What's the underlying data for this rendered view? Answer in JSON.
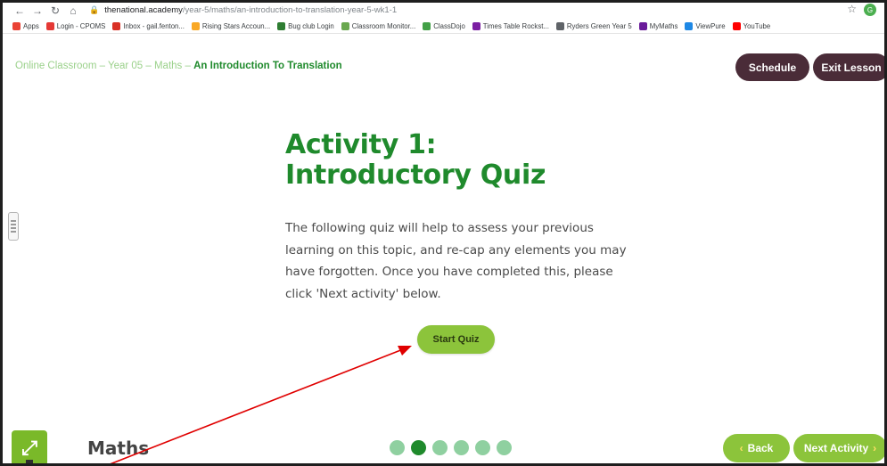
{
  "browser": {
    "url_host": "thenational.academy",
    "url_path": "/year-5/maths/an-introduction-to-translation-year-5-wk1-1",
    "profile_initial": "G",
    "bookmarks": [
      {
        "label": "Apps",
        "icon": "apps-grid-icon",
        "color": "#ea4335"
      },
      {
        "label": "Login - CPOMS",
        "icon": "cpoms-icon",
        "color": "#e53935"
      },
      {
        "label": "Inbox - gail.fenton...",
        "icon": "gmail-icon",
        "color": "#d93025"
      },
      {
        "label": "Rising Stars Accoun...",
        "icon": "rising-stars-icon",
        "color": "#f9a825"
      },
      {
        "label": "Bug club Login",
        "icon": "bug-club-icon",
        "color": "#2e7d32"
      },
      {
        "label": "Classroom Monitor...",
        "icon": "classroom-monitor-icon",
        "color": "#6aa84f"
      },
      {
        "label": "ClassDojo",
        "icon": "classdojo-icon",
        "color": "#43a047"
      },
      {
        "label": "Times Table Rockst...",
        "icon": "ttrs-icon",
        "color": "#7b1fa2"
      },
      {
        "label": "Ryders Green Year 5",
        "icon": "globe-icon",
        "color": "#5f6368"
      },
      {
        "label": "MyMaths",
        "icon": "mymaths-icon",
        "color": "#6a1b9a"
      },
      {
        "label": "ViewPure",
        "icon": "viewpure-icon",
        "color": "#1e88e5"
      },
      {
        "label": "YouTube",
        "icon": "youtube-icon",
        "color": "#ff0000"
      }
    ]
  },
  "lesson": {
    "breadcrumb_path": "Online Classroom – Year 05 – Maths – ",
    "breadcrumb_current": "An Introduction To Translation",
    "schedule_label": "Schedule",
    "exit_label": "Exit Lesson"
  },
  "activity": {
    "title_line1": "Activity 1:",
    "title_line2": "Introductory Quiz",
    "intro": "The following quiz will help to assess your previous learning on this topic, and re-cap any elements you may have forgotten. Once you have completed this, please click 'Next activity' below.",
    "start_label": "Start Quiz"
  },
  "footer": {
    "subject": "Maths",
    "progress": {
      "total": 6,
      "current": 2
    },
    "back_label": "Back",
    "next_label": "Next Activity"
  },
  "colors": {
    "brand_green": "#1f8a2c",
    "button_green": "#8cc43b",
    "header_button": "#4a2c38",
    "annotation_arrow": "#e00000"
  }
}
